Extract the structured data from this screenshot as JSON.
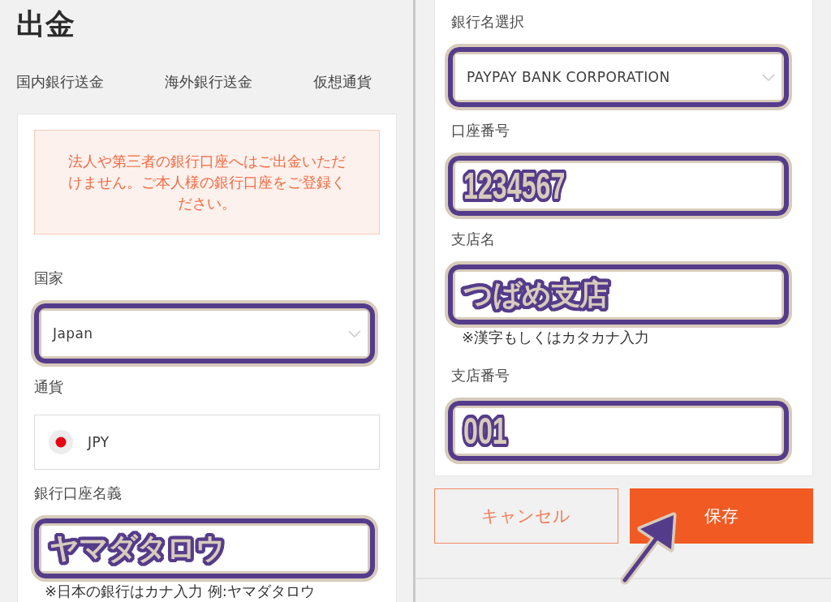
{
  "left_screen": {
    "title": "出金",
    "tabs": [
      "国内銀行送金",
      "海外銀行送金",
      "仮想通貨"
    ],
    "notice": "法人や第三者の銀行口座へはご出金いただけません。ご本人様の銀行口座をご登録ください。",
    "fields": [
      {
        "kind": "select",
        "label": "国家",
        "value": "Japan",
        "highlighted": true
      },
      {
        "kind": "currency",
        "label": "通貨",
        "value": "JPY",
        "highlighted": false
      },
      {
        "kind": "text",
        "label": "銀行口座名義",
        "value": "ヤマダタロウ",
        "highlighted": true,
        "hint": "※日本の銀行はカナ入力 例:ヤマダタロウ"
      }
    ]
  },
  "right_screen": {
    "fields": [
      {
        "kind": "select",
        "label": "銀行名選択",
        "value": "PAYPAY BANK CORPORATION",
        "highlighted": true
      },
      {
        "kind": "number",
        "label": "口座番号",
        "value": "1234567",
        "highlighted": true
      },
      {
        "kind": "text",
        "label": "支店名",
        "value": "つばめ支店",
        "highlighted": true,
        "hint": "※漢字もしくはカタカナ入力"
      },
      {
        "kind": "number",
        "label": "支店番号",
        "value": "001",
        "highlighted": true
      }
    ],
    "buttons": [
      {
        "kind": "cancel",
        "label": "キャンセル",
        "pointed": false
      },
      {
        "kind": "save",
        "label": "保存",
        "pointed": true
      }
    ]
  }
}
